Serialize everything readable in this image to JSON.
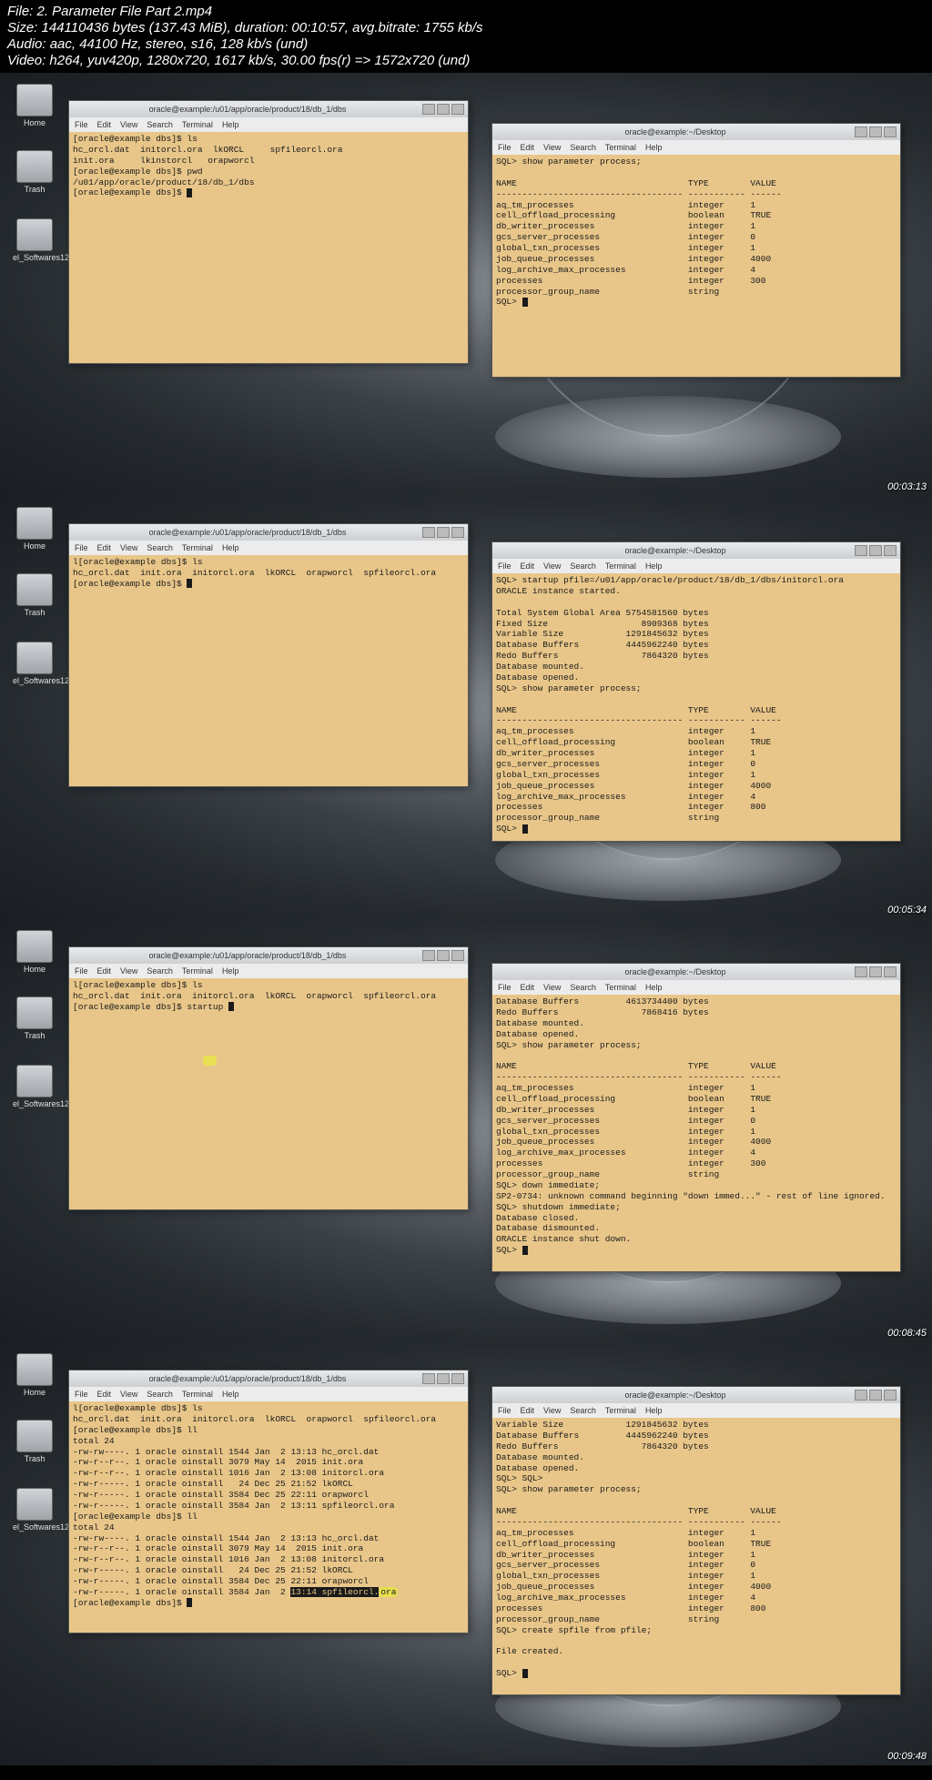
{
  "meta": {
    "file": "File: 2. Parameter File Part 2.mp4",
    "size": "Size: 144110436 bytes (137.43 MiB), duration: 00:10:57, avg.bitrate: 1755 kb/s",
    "audio": "Audio: aac, 44100 Hz, stereo, s16, 128 kb/s (und)",
    "video": "Video: h264, yuv420p, 1280x720, 1617 kb/s, 30.00 fps(r) => 1572x720 (und)"
  },
  "icons": {
    "home": "Home",
    "trash": "Trash",
    "soft": "el_Softwares12"
  },
  "menu": [
    "File",
    "Edit",
    "View",
    "Search",
    "Terminal",
    "Help"
  ],
  "win_titles": {
    "left_path": "oracle@example:/u01/app/oracle/product/18/db_1/dbs",
    "right_path": "oracle@example:~/Desktop"
  },
  "shot1": {
    "ts": "00:03:13",
    "left": "[oracle@example dbs]$ ls\nhc_orcl.dat  initorcl.ora  lkORCL     spfileorcl.ora\ninit.ora     lkinstorcl   orapworcl\n[oracle@example dbs]$ pwd\n/u01/app/oracle/product/18/db_1/dbs\n[oracle@example dbs]$ ",
    "right_pre": "SQL> show parameter process;\n\nNAME                                 TYPE        VALUE\n------------------------------------ ----------- ------",
    "right_rows": [
      "aq_tm_processes                      integer     1",
      "cell_offload_processing              boolean     TRUE",
      "db_writer_processes                  integer     1",
      "gcs_server_processes                 integer     0",
      "global_txn_processes                 integer     1",
      "job_queue_processes                  integer     4000",
      "log_archive_max_processes            integer     4",
      "processes                            integer     300",
      "processor_group_name                 string"
    ],
    "right_post": "SQL> "
  },
  "shot2": {
    "ts": "00:05:34",
    "left": "l[oracle@example dbs]$ ls\nhc_orcl.dat  init.ora  initorcl.ora  lkORCL  orapworcl  spfileorcl.ora\n[oracle@example dbs]$ ",
    "right": "SQL> startup pfile=/u01/app/oracle/product/18/db_1/dbs/initorcl.ora\nORACLE instance started.\n\nTotal System Global Area 5754581560 bytes\nFixed Size                  8909368 bytes\nVariable Size            1291845632 bytes\nDatabase Buffers         4445962240 bytes\nRedo Buffers                7864320 bytes\nDatabase mounted.\nDatabase opened.\nSQL> show parameter process;\n\nNAME                                 TYPE        VALUE\n------------------------------------ ----------- ------\naq_tm_processes                      integer     1\ncell_offload_processing              boolean     TRUE\ndb_writer_processes                  integer     1\ngcs_server_processes                 integer     0\nglobal_txn_processes                 integer     1\njob_queue_processes                  integer     4000\nlog_archive_max_processes            integer     4\nprocesses                            integer     800\nprocessor_group_name                 string\nSQL> "
  },
  "shot3": {
    "ts": "00:08:45",
    "left": "l[oracle@example dbs]$ ls\nhc_orcl.dat  init.ora  initorcl.ora  lkORCL  orapworcl  spfileorcl.ora\n[oracle@example dbs]$ startup ",
    "right": "Database Buffers         4613734400 bytes\nRedo Buffers                7868416 bytes\nDatabase mounted.\nDatabase opened.\nSQL> show parameter process;\n\nNAME                                 TYPE        VALUE\n------------------------------------ ----------- ------\naq_tm_processes                      integer     1\ncell_offload_processing              boolean     TRUE\ndb_writer_processes                  integer     1\ngcs_server_processes                 integer     0\nglobal_txn_processes                 integer     1\njob_queue_processes                  integer     4000\nlog_archive_max_processes            integer     4\nprocesses                            integer     300\nprocessor_group_name                 string\nSQL> down immediate;\nSP2-0734: unknown command beginning \"down immed...\" - rest of line ignored.\nSQL> shutdown immediate;\nDatabase closed.\nDatabase dismounted.\nORACLE instance shut down.\nSQL> "
  },
  "shot4": {
    "ts": "00:09:48",
    "left": "l[oracle@example dbs]$ ls\nhc_orcl.dat  init.ora  initorcl.ora  lkORCL  orapworcl  spfileorcl.ora\n[oracle@example dbs]$ ll\ntotal 24\n-rw-rw----. 1 oracle oinstall 1544 Jan  2 13:13 hc_orcl.dat\n-rw-r--r--. 1 oracle oinstall 3079 May 14  2015 init.ora\n-rw-r--r--. 1 oracle oinstall 1016 Jan  2 13:08 initorcl.ora\n-rw-r-----. 1 oracle oinstall   24 Dec 25 21:52 lkORCL\n-rw-r-----. 1 oracle oinstall 3584 Dec 25 22:11 orapworcl\n-rw-r-----. 1 oracle oinstall 3584 Jan  2 13:11 spfileorcl.ora\n[oracle@example dbs]$ ll\ntotal 24\n-rw-rw----. 1 oracle oinstall 1544 Jan  2 13:13 hc_orcl.dat\n-rw-r--r--. 1 oracle oinstall 3079 May 14  2015 init.ora\n-rw-r--r--. 1 oracle oinstall 1016 Jan  2 13:08 initorcl.ora\n-rw-r-----. 1 oracle oinstall   24 Dec 25 21:52 lkORCL\n-rw-r-----. 1 oracle oinstall 3584 Dec 25 22:11 orapworcl",
    "left_sel": "-rw-r-----. 1 oracle oinstall 3584 Jan  2 ",
    "left_sel2": "13:14 spfileorcl.",
    "left_hl": "ora",
    "left_post": "[oracle@example dbs]$ ",
    "right": "Variable Size            1291845632 bytes\nDatabase Buffers         4445962240 bytes\nRedo Buffers                7864320 bytes\nDatabase mounted.\nDatabase opened.\nSQL> SQL>\nSQL> show parameter process;\n\nNAME                                 TYPE        VALUE\n------------------------------------ ----------- ------\naq_tm_processes                      integer     1\ncell_offload_processing              boolean     TRUE\ndb_writer_processes                  integer     1\ngcs_server_processes                 integer     0\nglobal_txn_processes                 integer     1\njob_queue_processes                  integer     4000\nlog_archive_max_processes            integer     4\nprocesses                            integer     800\nprocessor_group_name                 string\nSQL> create spfile from pfile;\n\nFile created.\n\nSQL> "
  }
}
